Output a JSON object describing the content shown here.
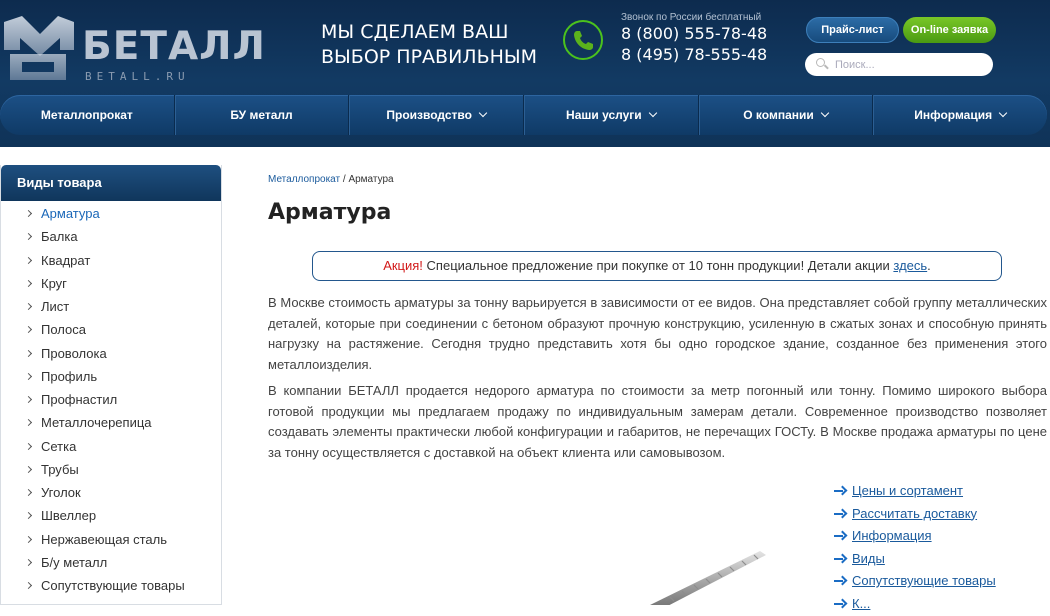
{
  "header": {
    "logo_text": "БЕТАЛЛ",
    "logo_sub": "BETALL.RU",
    "slogan_line1": "МЫ СДЕЛАЕМ ВАШ",
    "slogan_line2": "ВЫБОР ПРАВИЛЬНЫМ",
    "phone_note": "Звонок по России бесплатный",
    "phone1": "8 (800) 555-78-48",
    "phone2": "8 (495) 78-555-48",
    "price_button": "Прайс-лист",
    "order_button": "On-line заявка",
    "search_placeholder": "Поиск..."
  },
  "nav": {
    "items": [
      {
        "label": "Металлопрокат",
        "dropdown": false
      },
      {
        "label": "БУ металл",
        "dropdown": false
      },
      {
        "label": "Производство",
        "dropdown": true
      },
      {
        "label": "Наши услуги",
        "dropdown": true
      },
      {
        "label": "О компании",
        "dropdown": true
      },
      {
        "label": "Информация",
        "dropdown": true
      }
    ]
  },
  "sidebar": {
    "title": "Виды товара",
    "items": [
      "Арматура",
      "Балка",
      "Квадрат",
      "Круг",
      "Лист",
      "Полоса",
      "Проволока",
      "Профиль",
      "Профнастил",
      "Металлочерепица",
      "Сетка",
      "Трубы",
      "Уголок",
      "Швеллер",
      "Нержавеющая сталь",
      "Б/у металл",
      "Сопутствующие товары"
    ],
    "active_index": 0
  },
  "breadcrumb": {
    "parent": "Металлопрокат",
    "separator": " / ",
    "current": "Арматура"
  },
  "page_title": "Арматура",
  "promo": {
    "tag": "Акция!",
    "text": " Специальное предложение при покупке от 10 тонн продукции! Детали акции ",
    "link": "здесь",
    "end": "."
  },
  "paragraphs": [
    "В Москве стоимость арматуры за тонну варьируется в зависимости от ее видов. Она представляет собой группу металлических деталей, которые при соединении с бетоном образуют прочную конструкцию, усиленную в сжатых зонах и способную принять нагрузку на растяжение. Сегодня трудно представить хотя бы одно городское здание, созданное без применения этого металлоизделия.",
    "В компании БЕТАЛЛ продается недорого арматура по стоимости за метр погонный или тонну. Помимо широкого выбора готовой продукции мы предлагаем продажу по индивидуальным замерам детали. Современное производство позволяет создавать элементы практически любой конфигурации и габаритов, не перечащих ГОСТу. В Москве продажа арматуры по цене за тонну осуществляется с доставкой на объект клиента или самовывозом."
  ],
  "quick_links": [
    "Цены и сортамент",
    "Рассчитать доставку",
    "Информация",
    "Виды",
    "Сопутствующие товары",
    "К..."
  ],
  "colors": {
    "header_bg": "#0f3358",
    "accent_green": "#5bb31c",
    "link_blue": "#1a5a9c",
    "promo_red": "#d21919"
  }
}
